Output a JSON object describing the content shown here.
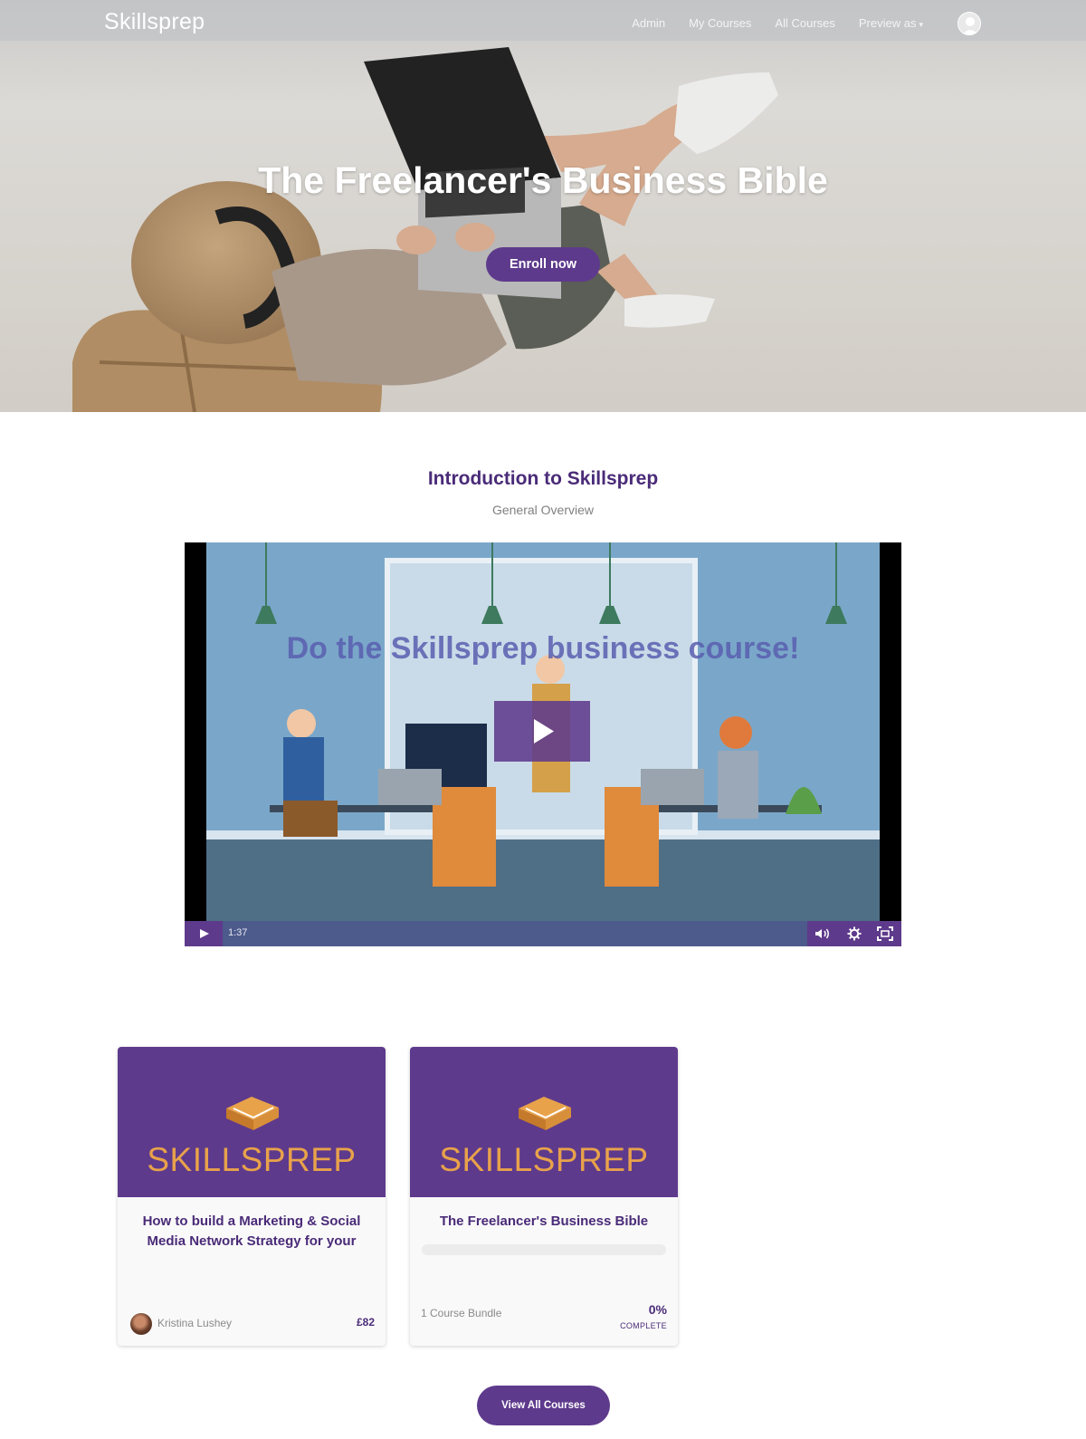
{
  "header": {
    "brand": "Skillsprep",
    "nav": [
      {
        "label": "Admin"
      },
      {
        "label": "My Courses"
      },
      {
        "label": "All Courses"
      },
      {
        "label": "Preview as"
      }
    ]
  },
  "hero": {
    "title": "The Freelancer's Business Bible",
    "enroll_label": "Enroll now"
  },
  "intro": {
    "title": "Introduction to Skillsprep",
    "subtitle": "General Overview"
  },
  "video": {
    "caption": "Do the Skillsprep business course!",
    "duration": "1:37",
    "icons": [
      "play-icon",
      "volume-icon",
      "gear-icon",
      "fullscreen-icon"
    ]
  },
  "courses": [
    {
      "logo_text": "SKILLSPREP",
      "title": "How to build a Marketing & Social Media Network Strategy for your",
      "author": "Kristina Lushey",
      "price": "£82"
    },
    {
      "logo_text": "SKILLSPREP",
      "title": "The Freelancer's Business Bible",
      "bundle": "1 Course Bundle",
      "progress_percent": 0,
      "progress_label": "0%",
      "complete_label": "COMPLETE"
    }
  ],
  "view_all_label": "View All Courses",
  "colors": {
    "brand_purple": "#5e3a8c",
    "heading_purple": "#4a2b78",
    "logo_orange": "#e8a24a"
  }
}
